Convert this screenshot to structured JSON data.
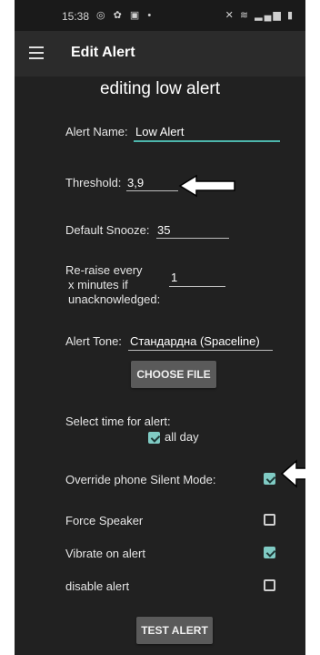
{
  "status_bar": {
    "time": "15:38",
    "left_icons": "◎ ✿ ▣ •",
    "right_icons": "✕ ≋ ▂▄▆ ▮"
  },
  "app_bar": {
    "title": "Edit Alert"
  },
  "heading": "editing low alert",
  "form": {
    "alert_name_label": "Alert Name:",
    "alert_name_value": "Low Alert",
    "threshold_label": "Threshold:",
    "threshold_value": "3,9",
    "snooze_label": "Default Snooze:",
    "snooze_value": "35",
    "reraise_line1": "Re-raise every",
    "reraise_line2": "x minutes if",
    "reraise_line3": "unacknowledged:",
    "reraise_value": "1",
    "tone_label": "Alert Tone:",
    "tone_value": "Стандардна (Spaceline)",
    "choose_file": "CHOOSE FILE",
    "select_time_label": "Select time for alert:",
    "all_day_label": "all day",
    "all_day_checked": true
  },
  "options": [
    {
      "label": "Override phone Silent Mode:",
      "checked": true
    },
    {
      "label": "Force Speaker",
      "checked": false
    },
    {
      "label": "Vibrate on alert",
      "checked": true
    },
    {
      "label": "disable alert",
      "checked": false
    }
  ],
  "test_alert": "TEST ALERT",
  "colors": {
    "accent": "#80cbc4",
    "background": "#212121",
    "appbar": "#2b2b2b"
  }
}
